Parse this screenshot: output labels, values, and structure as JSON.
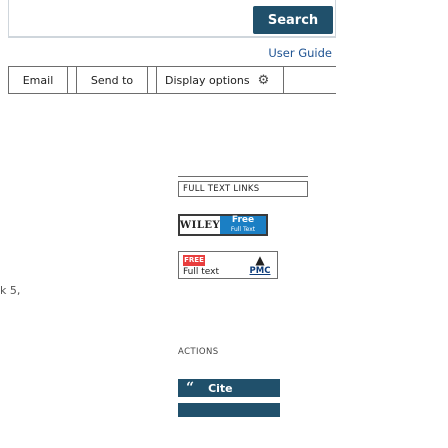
{
  "search": {
    "button_label": "Search"
  },
  "header": {
    "user_guide_label": "User Guide"
  },
  "toolbar": {
    "email_label": "Email",
    "send_to_label": "Send to",
    "display_options_label": "Display options",
    "display_options_icon": "gear-icon"
  },
  "stray_text": "k 5,",
  "full_text_links": {
    "heading": "FULL TEXT LINKS",
    "wiley": {
      "publisher": "WILEY",
      "badge_line1": "Free",
      "badge_line2": "Full Text"
    },
    "pmc": {
      "free_badge": "FREE",
      "full_text_label": "Full text",
      "logo_text": "PMC"
    }
  },
  "actions": {
    "heading": "ACTIONS",
    "cite_label": "Cite",
    "cite_icon": "quote-icon"
  },
  "colors": {
    "primary_button": "#20506b",
    "link": "#205493",
    "wiley_blue": "#1b7fc4",
    "free_red": "#e83e3e"
  }
}
